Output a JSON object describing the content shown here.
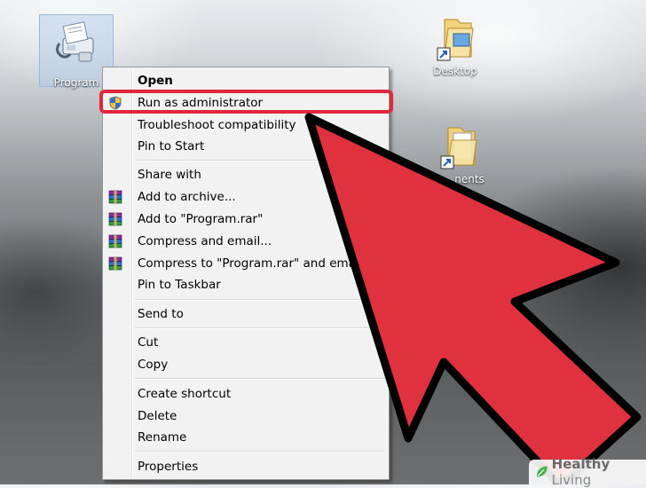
{
  "desktop": {
    "icons": [
      {
        "label": "Program"
      },
      {
        "label": "Desktop"
      },
      {
        "label": "nents"
      }
    ]
  },
  "context_menu": {
    "groups": [
      [
        {
          "label": "Open",
          "bold": true,
          "icon": ""
        },
        {
          "label": "Run as administrator",
          "icon": "uac-shield-icon",
          "highlighted": true
        },
        {
          "label": "Troubleshoot compatibility",
          "icon": ""
        },
        {
          "label": "Pin to Start",
          "icon": ""
        }
      ],
      [
        {
          "label": "Share with",
          "icon": ""
        },
        {
          "label": "Add to archive...",
          "icon": "winrar-icon"
        },
        {
          "label": "Add to \"Program.rar\"",
          "icon": "winrar-icon"
        },
        {
          "label": "Compress and email...",
          "icon": "winrar-icon"
        },
        {
          "label": "Compress to \"Program.rar\" and email",
          "icon": "winrar-icon"
        },
        {
          "label": "Pin to Taskbar",
          "icon": ""
        }
      ],
      [
        {
          "label": "Send to",
          "icon": ""
        }
      ],
      [
        {
          "label": "Cut",
          "icon": ""
        },
        {
          "label": "Copy",
          "icon": ""
        }
      ],
      [
        {
          "label": "Create shortcut",
          "icon": ""
        },
        {
          "label": "Delete",
          "icon": ""
        },
        {
          "label": "Rename",
          "icon": ""
        }
      ],
      [
        {
          "label": "Properties",
          "icon": ""
        }
      ]
    ]
  },
  "annotation": {
    "highlight_color": "#e0273e",
    "arrow_fill": "#e0313f",
    "arrow_stroke": "#000000"
  },
  "watermark": {
    "brand_part1": "Healthy",
    "brand_part2": "Living"
  }
}
